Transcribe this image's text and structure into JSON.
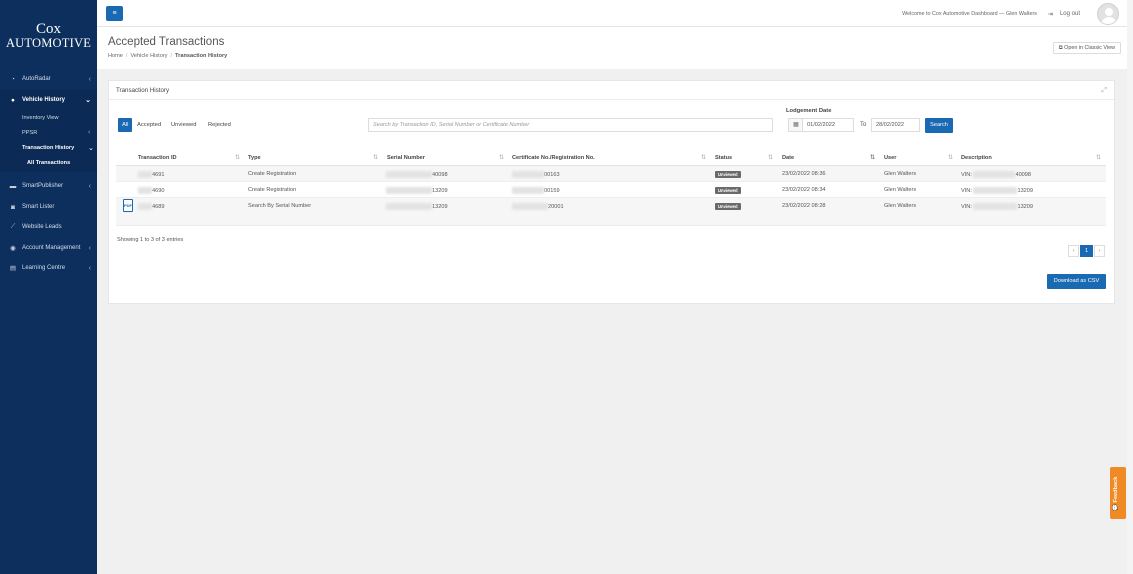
{
  "brand": {
    "line1": "Cox",
    "line2": "Automotive"
  },
  "sidebar": {
    "items": [
      {
        "label": "AutoRadar",
        "icon": "gauge-icon",
        "glyph": "◔"
      },
      {
        "label": "Vehicle History",
        "icon": "dot-icon",
        "glyph": "●"
      },
      {
        "label": "SmartPublisher",
        "icon": "car-icon",
        "glyph": "▬"
      },
      {
        "label": "Smart Lister",
        "icon": "camera-icon",
        "glyph": "◙"
      },
      {
        "label": "Website Leads",
        "icon": "chart-line-icon",
        "glyph": "⟋"
      },
      {
        "label": "Account Management",
        "icon": "user-circle-icon",
        "glyph": "◉"
      },
      {
        "label": "Learning Centre",
        "icon": "book-icon",
        "glyph": "▤"
      }
    ],
    "sub_items": [
      "Inventory View",
      "PPSR",
      "Transaction History",
      "All Transactions"
    ]
  },
  "topbar": {
    "menu_glyph": "≡",
    "welcome": "Welcome to Cox Automotive Dashboard — Glen Walters",
    "logout_glyph": "⇥",
    "logout": "Log out"
  },
  "page": {
    "title": "Accepted Transactions",
    "breadcrumb": [
      "Home",
      "Vehicle History",
      "Transaction History"
    ],
    "classic_button": "Open in Classic View"
  },
  "panel": {
    "title": "Transaction History",
    "filters": [
      "All",
      "Accepted",
      "Unviewed",
      "Rejected"
    ],
    "active_filter": "All",
    "search_placeholder": "Search by Transaction ID, Serial Number or Certificate Number",
    "lodgement_label": "Lodgement Date",
    "date_from": "01/02/2022",
    "to_label": "To",
    "date_to": "28/02/2022",
    "search_button": "Search",
    "columns": [
      "Transaction ID",
      "Type",
      "Serial Number",
      "Certificate No./Registration No.",
      "Status",
      "Date",
      "User",
      "Description"
    ],
    "rows": [
      {
        "id": "4691",
        "type": "Create Registration",
        "serial": "40098",
        "cert": "00163",
        "status": "Unviewed",
        "date": "23/02/2022 08:36",
        "user": "Glen Walters",
        "desc_prefix": "VIN:",
        "desc": "40098",
        "pdf": false
      },
      {
        "id": "4690",
        "type": "Create Registration",
        "serial": "13209",
        "cert": "00159",
        "status": "Unviewed",
        "date": "23/02/2022 08:34",
        "user": "Glen Walters",
        "desc_prefix": "VIN:",
        "desc": "13209",
        "pdf": false
      },
      {
        "id": "4689",
        "type": "Search By Serial Number",
        "serial": "13209",
        "cert": "20001",
        "status": "Unviewed",
        "date": "23/02/2022 08:28",
        "user": "Glen Walters",
        "desc_prefix": "VIN:",
        "desc": "13209",
        "pdf": true
      }
    ],
    "showing": "Showing 1 to 3 of 3 entries",
    "pagination": {
      "prev": "‹",
      "current": "1",
      "next": "›"
    },
    "download_button": "Download as CSV"
  },
  "feedback": "Feedback",
  "colors": {
    "sidebar": "#0d2f5e",
    "primary": "#1a6ab3",
    "feedback": "#f08a24",
    "badge": "#6a6a6a"
  }
}
